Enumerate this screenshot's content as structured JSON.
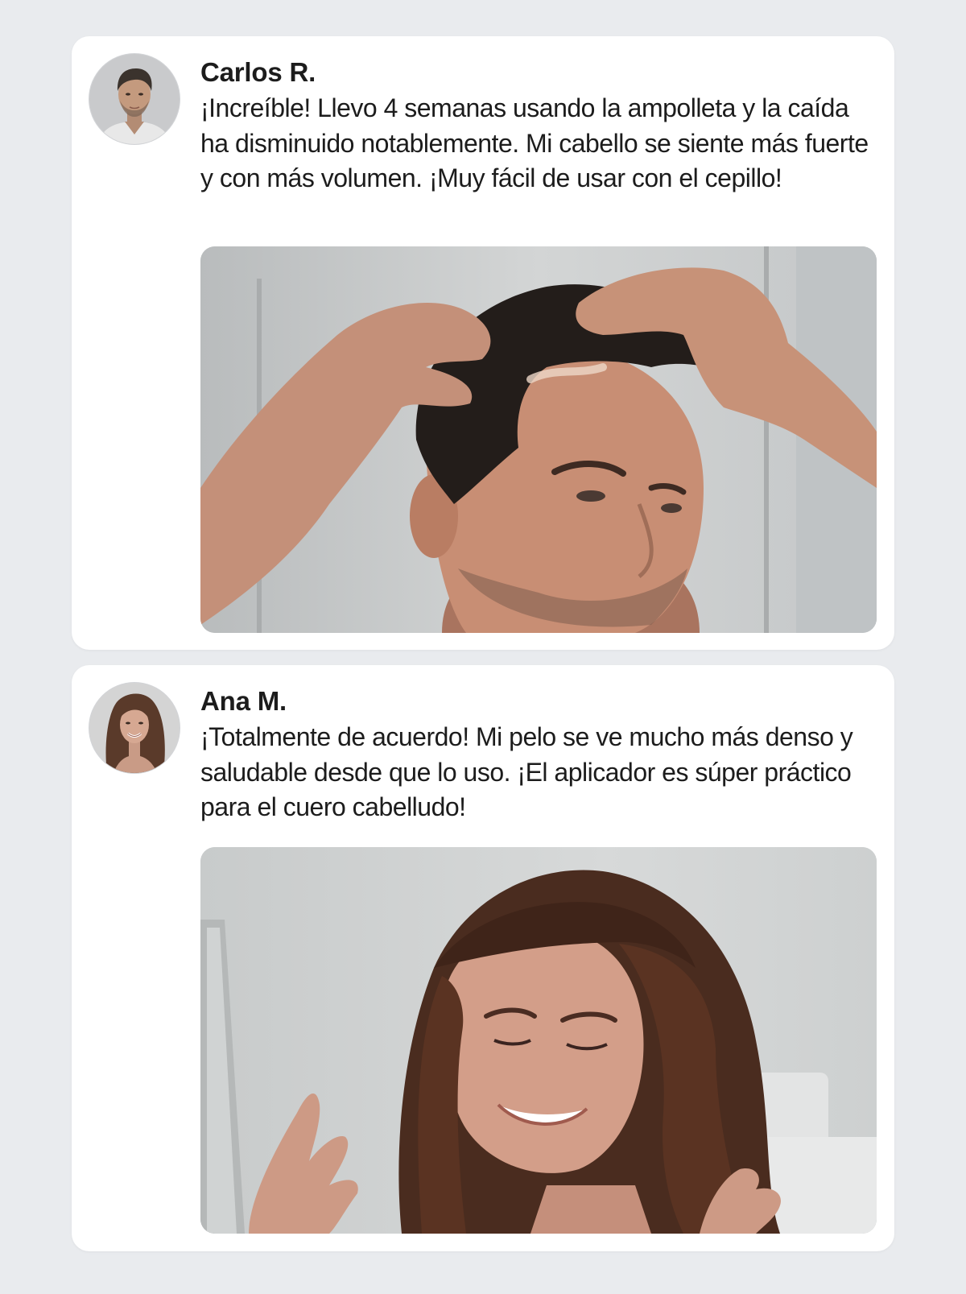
{
  "comments": [
    {
      "author": "Carlos R.",
      "text": "¡Increíble! Llevo 4 semanas usando la ampolleta y la caída ha disminuido notablemente. Mi cabello se siente más fuerte y con más volumen. ¡Muy fácil de usar con el cepillo!",
      "avatar_icon": "man-portrait",
      "photo_icon": "man-applying-serum-photo"
    },
    {
      "author": "Ana M.",
      "text": "¡Totalmente de acuerdo! Mi pelo se ve mucho más denso y saludable desde que lo uso. ¡El aplicador es súper práctico para el cuero cabelludo!",
      "avatar_icon": "woman-portrait",
      "photo_icon": "woman-smiling-photo"
    }
  ],
  "colors": {
    "page_background": "#e9ebee",
    "card_background": "#ffffff",
    "text": "#1c1c1c"
  }
}
